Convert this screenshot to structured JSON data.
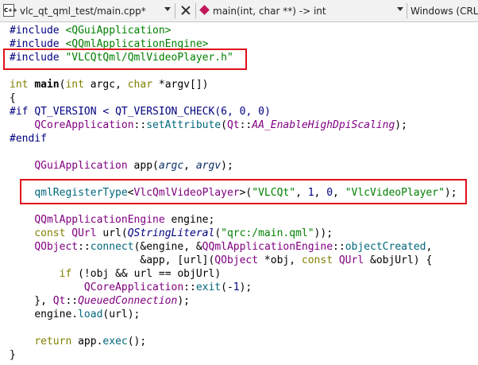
{
  "toolbar": {
    "file_icon": "C++",
    "file_name": "vlc_qt_qml_test/main.cpp*",
    "function_symbol": "main(int, char **) -> int",
    "line_ending": "Windows (CRLF)"
  },
  "code": {
    "l1": [
      "#include",
      " ",
      "<QGuiApplication>"
    ],
    "l2": [
      "#include",
      " ",
      "<QQmlApplicationEngine>"
    ],
    "l3": [
      "#include",
      " ",
      "\"VLCQtQml/QmlVideoPlayer.h\""
    ],
    "l5": [
      "int",
      " ",
      "main",
      "(",
      "int",
      " ",
      "argc",
      ",",
      " ",
      "char",
      " ",
      "*",
      "argv",
      "[])"
    ],
    "l6": [
      "{"
    ],
    "l7": [
      "#if",
      " ",
      "QT_VERSION",
      " < ",
      "QT_VERSION_CHECK",
      "(",
      "6",
      ", ",
      "0",
      ", ",
      "0",
      ")"
    ],
    "l8": [
      "    ",
      "QCoreApplication",
      "::",
      "setAttribute",
      "(",
      "Qt",
      "::",
      "AA_EnableHighDpiScaling",
      ");"
    ],
    "l9": [
      "#endif"
    ],
    "l11": [
      "    ",
      "QGuiApplication",
      " ",
      "app",
      "(",
      "argc",
      ", ",
      "argv",
      ");"
    ],
    "l13": [
      "    ",
      "qmlRegisterType",
      "<",
      "VlcQmlVideoPlayer",
      ">(",
      "\"VLCQt\"",
      ", ",
      "1",
      ", ",
      "0",
      ", ",
      "\"VlcVideoPlayer\"",
      ");"
    ],
    "l15": [
      "    ",
      "QQmlApplicationEngine",
      " ",
      "engine",
      ";"
    ],
    "l16": [
      "    ",
      "const",
      " ",
      "QUrl",
      " ",
      "url",
      "(",
      "QStringLiteral",
      "(",
      "\"qrc:/main.qml\"",
      "));"
    ],
    "l17": [
      "    ",
      "QObject",
      "::",
      "connect",
      "(&",
      "engine",
      ", &",
      "QQmlApplicationEngine",
      "::",
      "objectCreated",
      ","
    ],
    "l18": [
      "                     ",
      "&app, [url](",
      "QObject",
      " *",
      "obj",
      ", ",
      "const",
      " ",
      "QUrl",
      " &",
      "objUrl",
      ") {"
    ],
    "l19": [
      "        ",
      "if",
      " (!",
      "obj",
      " && ",
      "url",
      " == ",
      "objUrl",
      ")"
    ],
    "l20": [
      "            ",
      "QCoreApplication",
      "::",
      "exit",
      "(-",
      "1",
      ");"
    ],
    "l21": [
      "    }, ",
      "Qt",
      "::",
      "QueuedConnection",
      ");"
    ],
    "l22": [
      "    ",
      "engine",
      ".",
      "load",
      "(",
      "url",
      ");"
    ],
    "l24": [
      "    ",
      "return",
      " ",
      "app",
      ".",
      "exec",
      "();"
    ],
    "l25": [
      "}"
    ]
  },
  "colors": {
    "highlight_box": "#e0111a",
    "preprocessor": "#000080",
    "string": "#008000",
    "keyword": "#808000",
    "type": "#800080"
  }
}
